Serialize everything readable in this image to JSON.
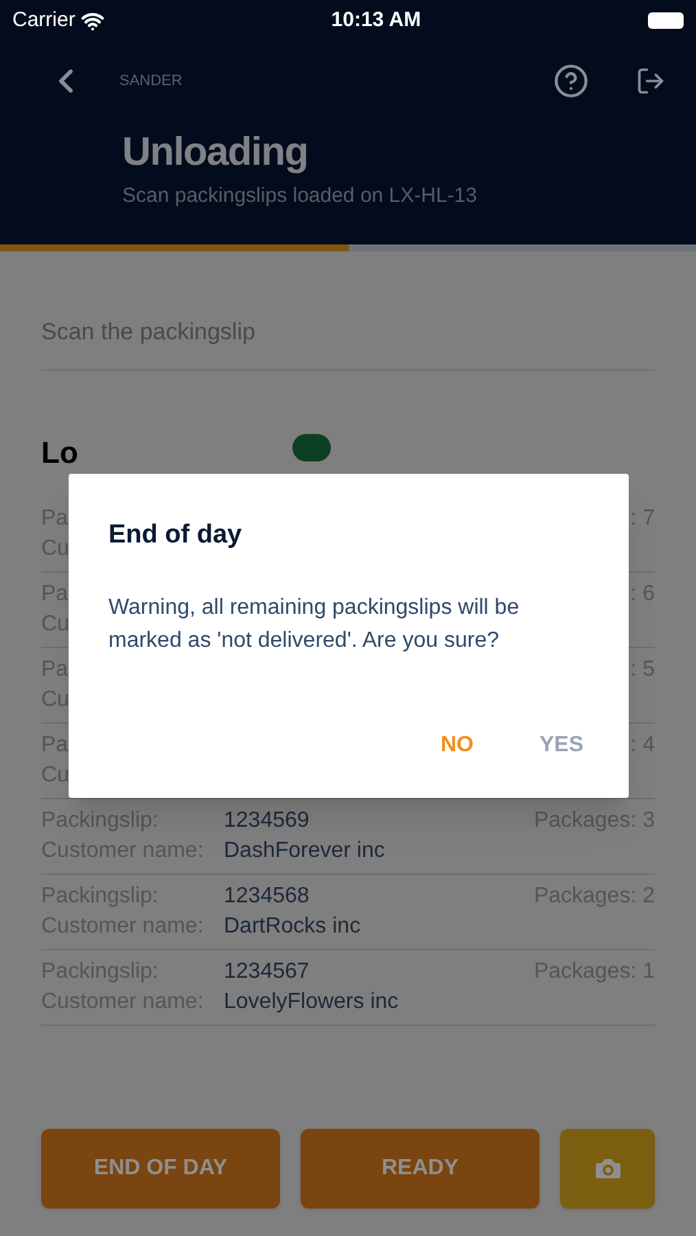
{
  "status_bar": {
    "carrier": "Carrier",
    "time": "10:13 AM"
  },
  "header": {
    "user": "SANDER",
    "title": "Unloading",
    "subtitle": "Scan packingslips loaded on LX-HL-13"
  },
  "progress": {
    "level": 0.5
  },
  "scan_field": {
    "placeholder": "Scan the packingslip"
  },
  "list_heading": "Lo",
  "rows": [
    {
      "packingslip_label": "Pa",
      "customer_label": "Cu",
      "packages": ": 7"
    },
    {
      "packingslip_label": "Pa",
      "customer_label": "Cu",
      "packages": ": 6"
    },
    {
      "packingslip_label": "Pa",
      "customer_label": "Cu",
      "packages": ": 5"
    },
    {
      "packingslip_label": "Pa",
      "customer_label": "Cu",
      "packages": ": 4"
    },
    {
      "packingslip_label": "Packingslip:",
      "packingslip": "1234569",
      "customer_label": "Customer name:",
      "customer": "DashForever inc",
      "packages": "Packages: 3"
    },
    {
      "packingslip_label": "Packingslip:",
      "packingslip": "1234568",
      "customer_label": "Customer name:",
      "customer": "DartRocks inc",
      "packages": "Packages: 2"
    },
    {
      "packingslip_label": "Packingslip:",
      "packingslip": "1234567",
      "customer_label": "Customer name:",
      "customer": "LovelyFlowers inc",
      "packages": "Packages: 1"
    }
  ],
  "buttons": [
    {
      "kind": "text",
      "label": "END OF DAY"
    },
    {
      "kind": "text",
      "label": "READY"
    },
    {
      "kind": "camera"
    }
  ],
  "dialog": {
    "title": "End of day",
    "message": "Warning, all remaining packingslips will be marked as 'not delivered'. Are you sure?",
    "actions": [
      {
        "label": "NO",
        "primary": true
      },
      {
        "label": "YES",
        "primary": false
      }
    ]
  }
}
